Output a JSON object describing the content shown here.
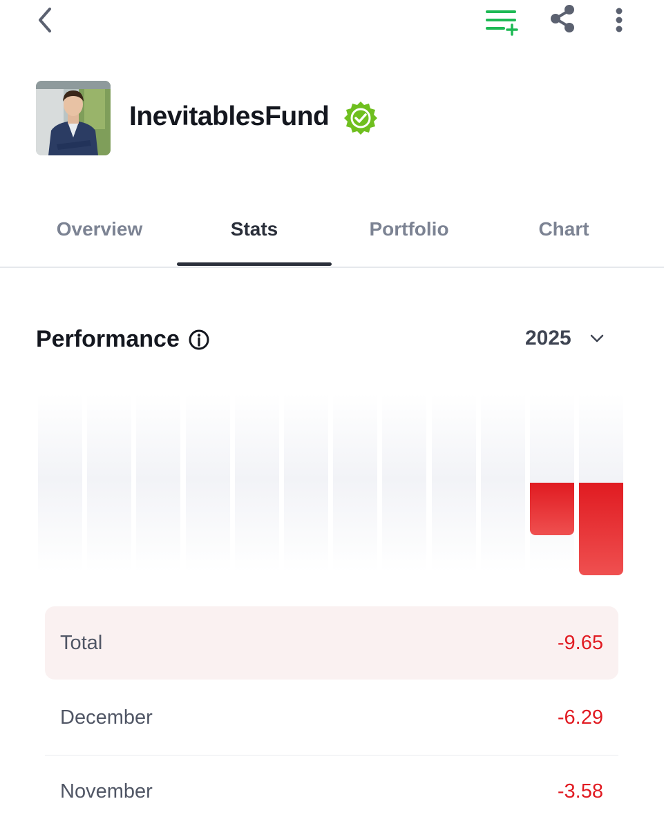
{
  "header": {
    "back_icon": "chevron-left-icon",
    "watchlist_icon": "add-to-list-icon",
    "share_icon": "share-icon",
    "more_icon": "more-vertical-icon",
    "accent_green": "#1db954"
  },
  "profile": {
    "username": "InevitablesFund",
    "verified_icon": "verified-badge-icon",
    "badge_color": "#6fbf1f"
  },
  "tabs": [
    {
      "label": "Overview"
    },
    {
      "label": "Stats",
      "active": true
    },
    {
      "label": "Portfolio"
    },
    {
      "label": "Chart"
    }
  ],
  "performance": {
    "title": "Performance",
    "info_icon": "info-icon",
    "year": "2025",
    "chevron_icon": "chevron-down-icon"
  },
  "chart_data": {
    "type": "bar",
    "categories": [
      "",
      "",
      "",
      "",
      "",
      "",
      "",
      "",
      "",
      "",
      "",
      ""
    ],
    "values": [
      null,
      null,
      null,
      null,
      null,
      null,
      null,
      null,
      null,
      null,
      -3.58,
      -6.29
    ],
    "negative_color": "#e01b21"
  },
  "rows": {
    "total": {
      "label": "Total",
      "value": "-9.65"
    },
    "months": [
      {
        "label": "December",
        "value": "-6.29"
      },
      {
        "label": "November",
        "value": "-3.58"
      }
    ]
  }
}
